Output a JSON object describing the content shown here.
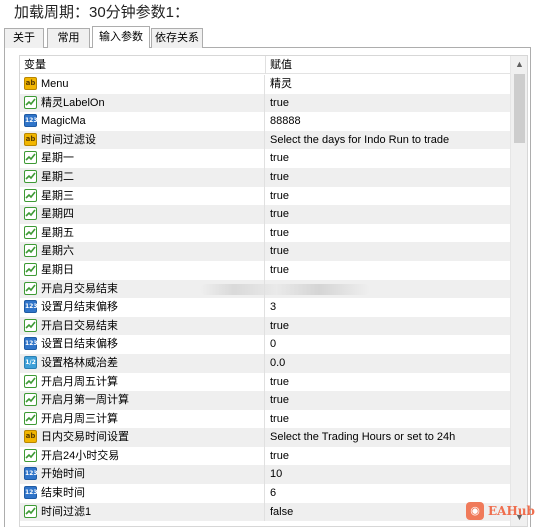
{
  "caption": "加载周期：30分钟参数1：",
  "tabs": [
    {
      "label": "关于"
    },
    {
      "label": "常用"
    },
    {
      "label": "输入参数"
    },
    {
      "label": "依存关系"
    }
  ],
  "table": {
    "headers": {
      "variable": "变量",
      "value": "赋值"
    },
    "rows": [
      {
        "type": "ab",
        "name": "Menu",
        "value": "精灵"
      },
      {
        "type": "bool",
        "name": "精灵LabelOn",
        "value": "true"
      },
      {
        "type": "num",
        "name": "MagicMa",
        "value": "88888"
      },
      {
        "type": "ab",
        "name": "时间过滤设",
        "value": "Select the days for Indo Run to trade"
      },
      {
        "type": "bool",
        "name": "星期一",
        "value": "true"
      },
      {
        "type": "bool",
        "name": "星期二",
        "value": "true"
      },
      {
        "type": "bool",
        "name": "星期三",
        "value": "true"
      },
      {
        "type": "bool",
        "name": "星期四",
        "value": "true"
      },
      {
        "type": "bool",
        "name": "星期五",
        "value": "true"
      },
      {
        "type": "bool",
        "name": "星期六",
        "value": "true"
      },
      {
        "type": "bool",
        "name": "星期日",
        "value": "true"
      },
      {
        "type": "bool",
        "name": "开启月交易结束",
        "value": ""
      },
      {
        "type": "num",
        "name": "设置月结束偏移",
        "value": "3"
      },
      {
        "type": "bool",
        "name": "开启日交易结束",
        "value": "true"
      },
      {
        "type": "num",
        "name": "设置日结束偏移",
        "value": "0"
      },
      {
        "type": "dbl",
        "name": "设置格林威治差",
        "value": "0.0"
      },
      {
        "type": "bool",
        "name": "开启月周五计算",
        "value": "true"
      },
      {
        "type": "bool",
        "name": "开启月第一周计算",
        "value": "true"
      },
      {
        "type": "bool",
        "name": "开启月周三计算",
        "value": "true"
      },
      {
        "type": "ab",
        "name": "日内交易时间设置",
        "value": "Select the Trading Hours or set to 24h"
      },
      {
        "type": "bool",
        "name": "开启24小时交易",
        "value": "true"
      },
      {
        "type": "num",
        "name": "开始时间",
        "value": "10"
      },
      {
        "type": "num",
        "name": "结束时间",
        "value": "6"
      },
      {
        "type": "bool",
        "name": "时间过滤1",
        "value": "false"
      }
    ]
  },
  "icon_glyphs": {
    "ab": "ab",
    "num": "123",
    "dbl": "1/2",
    "bool": "✓"
  },
  "watermark": {
    "text": "EAHub"
  },
  "colors": {
    "bool_icon": "#3e9a35",
    "ab_icon": "#f2b600",
    "num_icon": "#2f74c9",
    "alt_row": "#efefef"
  }
}
